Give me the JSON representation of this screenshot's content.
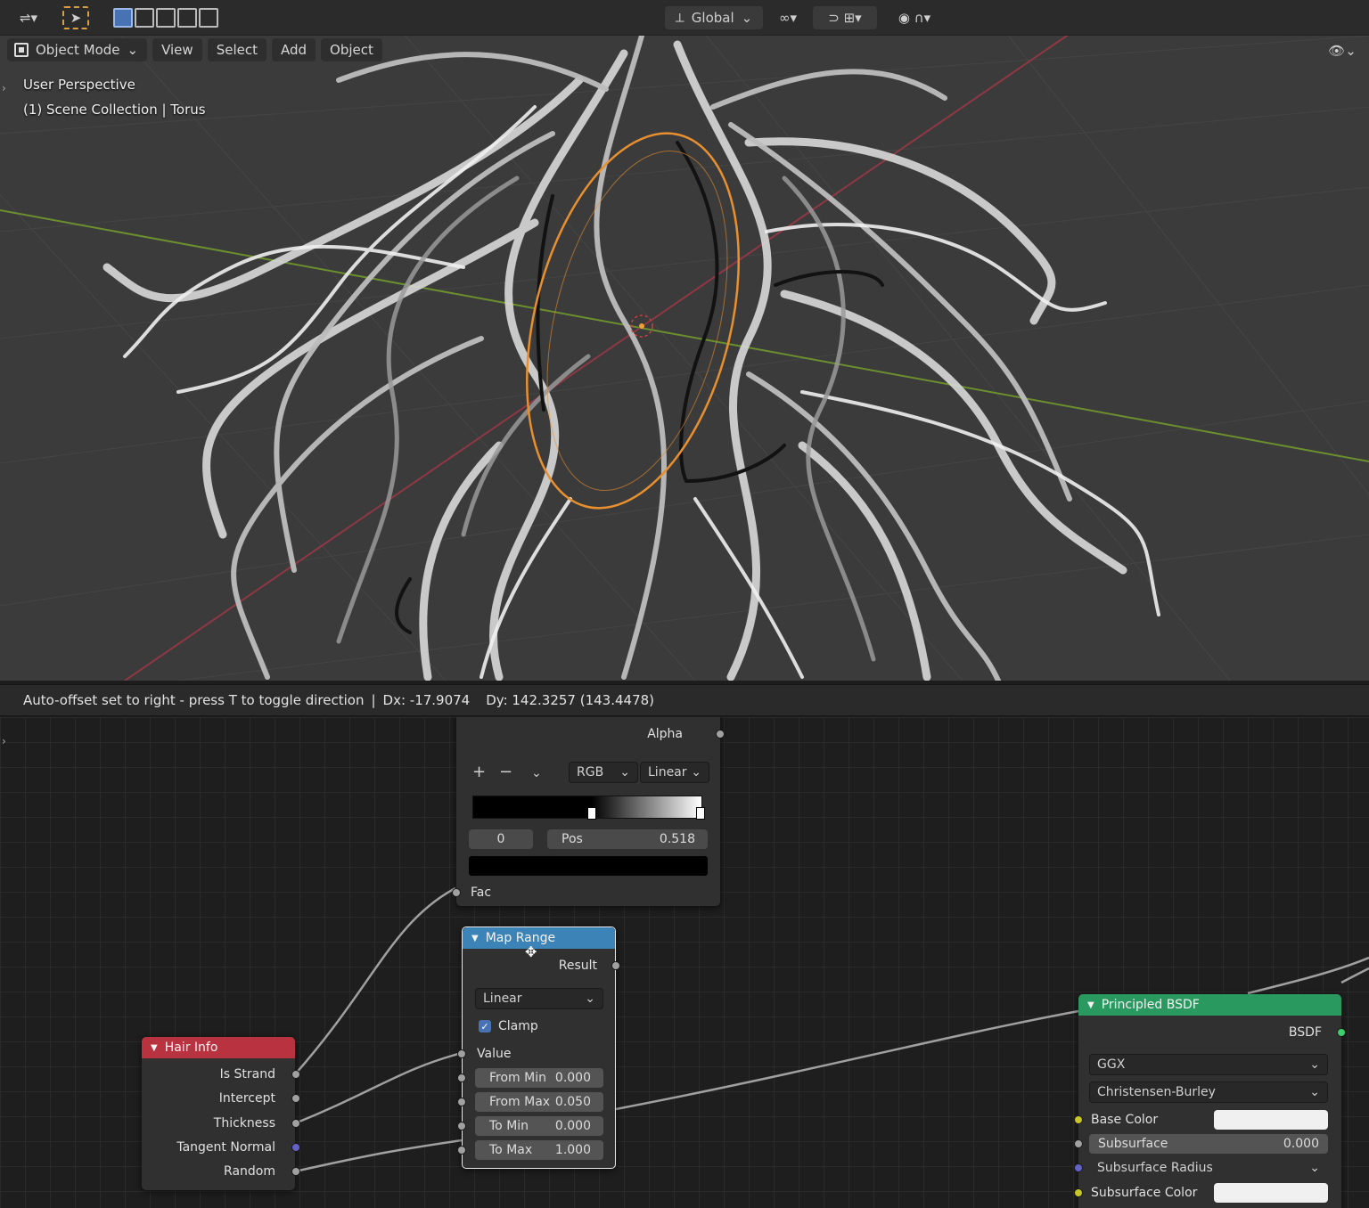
{
  "viewport": {
    "header": {
      "mode_label": "Object Mode",
      "menu": [
        "View",
        "Select",
        "Add",
        "Object"
      ],
      "transform_orientation": "Global"
    },
    "overlay": {
      "view_name": "User Perspective",
      "collection_info": "(1) Scene Collection | Torus"
    }
  },
  "status": {
    "message": "Auto-offset set to right - press T to toggle direction",
    "separator": "|",
    "dx": "Dx: -17.9074",
    "dy": "Dy: 142.3257 (143.4478)"
  },
  "color_ramp_node": {
    "alpha_label": "Alpha",
    "plus": "+",
    "minus": "−",
    "color_mode": "RGB",
    "interpolation": "Linear",
    "stop_index": "0",
    "pos_label": "Pos",
    "pos_value": "0.518",
    "fac_label": "Fac"
  },
  "map_range_node": {
    "title": "Map Range",
    "result_label": "Result",
    "interpolation": "Linear",
    "clamp_label": "Clamp",
    "clamp_checked": true,
    "value_label": "Value",
    "fields": [
      {
        "label": "From Min",
        "value": "0.000"
      },
      {
        "label": "From Max",
        "value": "0.050"
      },
      {
        "label": "To Min",
        "value": "0.000"
      },
      {
        "label": "To Max",
        "value": "1.000"
      }
    ]
  },
  "hair_info_node": {
    "title": "Hair Info",
    "outputs": [
      "Is Strand",
      "Intercept",
      "Thickness",
      "Tangent Normal",
      "Random"
    ]
  },
  "principled_node": {
    "title": "Principled BSDF",
    "output_label": "BSDF",
    "distribution": "GGX",
    "subsurface_method": "Christensen-Burley",
    "base_color_label": "Base Color",
    "subsurface_label": "Subsurface",
    "subsurface_value": "0.000",
    "subsurface_radius_label": "Subsurface Radius",
    "subsurface_color_label": "Subsurface Color"
  },
  "colors": {
    "hair_info_header": "#b8333f",
    "map_range_header": "#3c83b8",
    "principled_header": "#2a9960",
    "selection_outline": "#e8902f",
    "x_axis": "#8e3844",
    "y_axis": "#6b8f2e"
  }
}
